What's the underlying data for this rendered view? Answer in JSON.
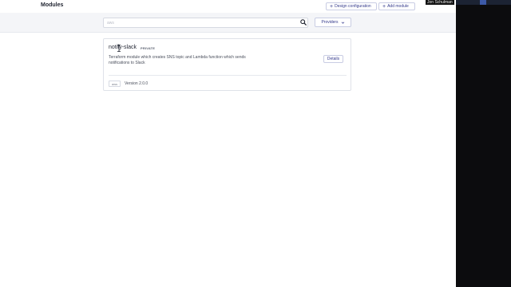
{
  "header": {
    "title": "Modules",
    "design_config_label": "Design configuration",
    "add_module_label": "Add module"
  },
  "search": {
    "placeholder": "aws",
    "providers_label": "Providers"
  },
  "module": {
    "name": "notify-slack",
    "visibility_badge": "PRIVATE",
    "description": "Terraform module which creates SNS topic and Lambda function which sends notifications to Slack",
    "details_label": "Details",
    "provider": "aws",
    "version": "Version 2.0.0"
  },
  "overlay": {
    "participant_name": "Jon Schulman"
  },
  "colors": {
    "accent": "#343a8c",
    "background_band": "#f4f5f8",
    "border": "#dfe2e9",
    "right_panel": "#0c0c0e"
  },
  "icons": {
    "search": "search-icon",
    "providers_dropdown": "chevron-down-icon",
    "add": "plus-icon"
  }
}
